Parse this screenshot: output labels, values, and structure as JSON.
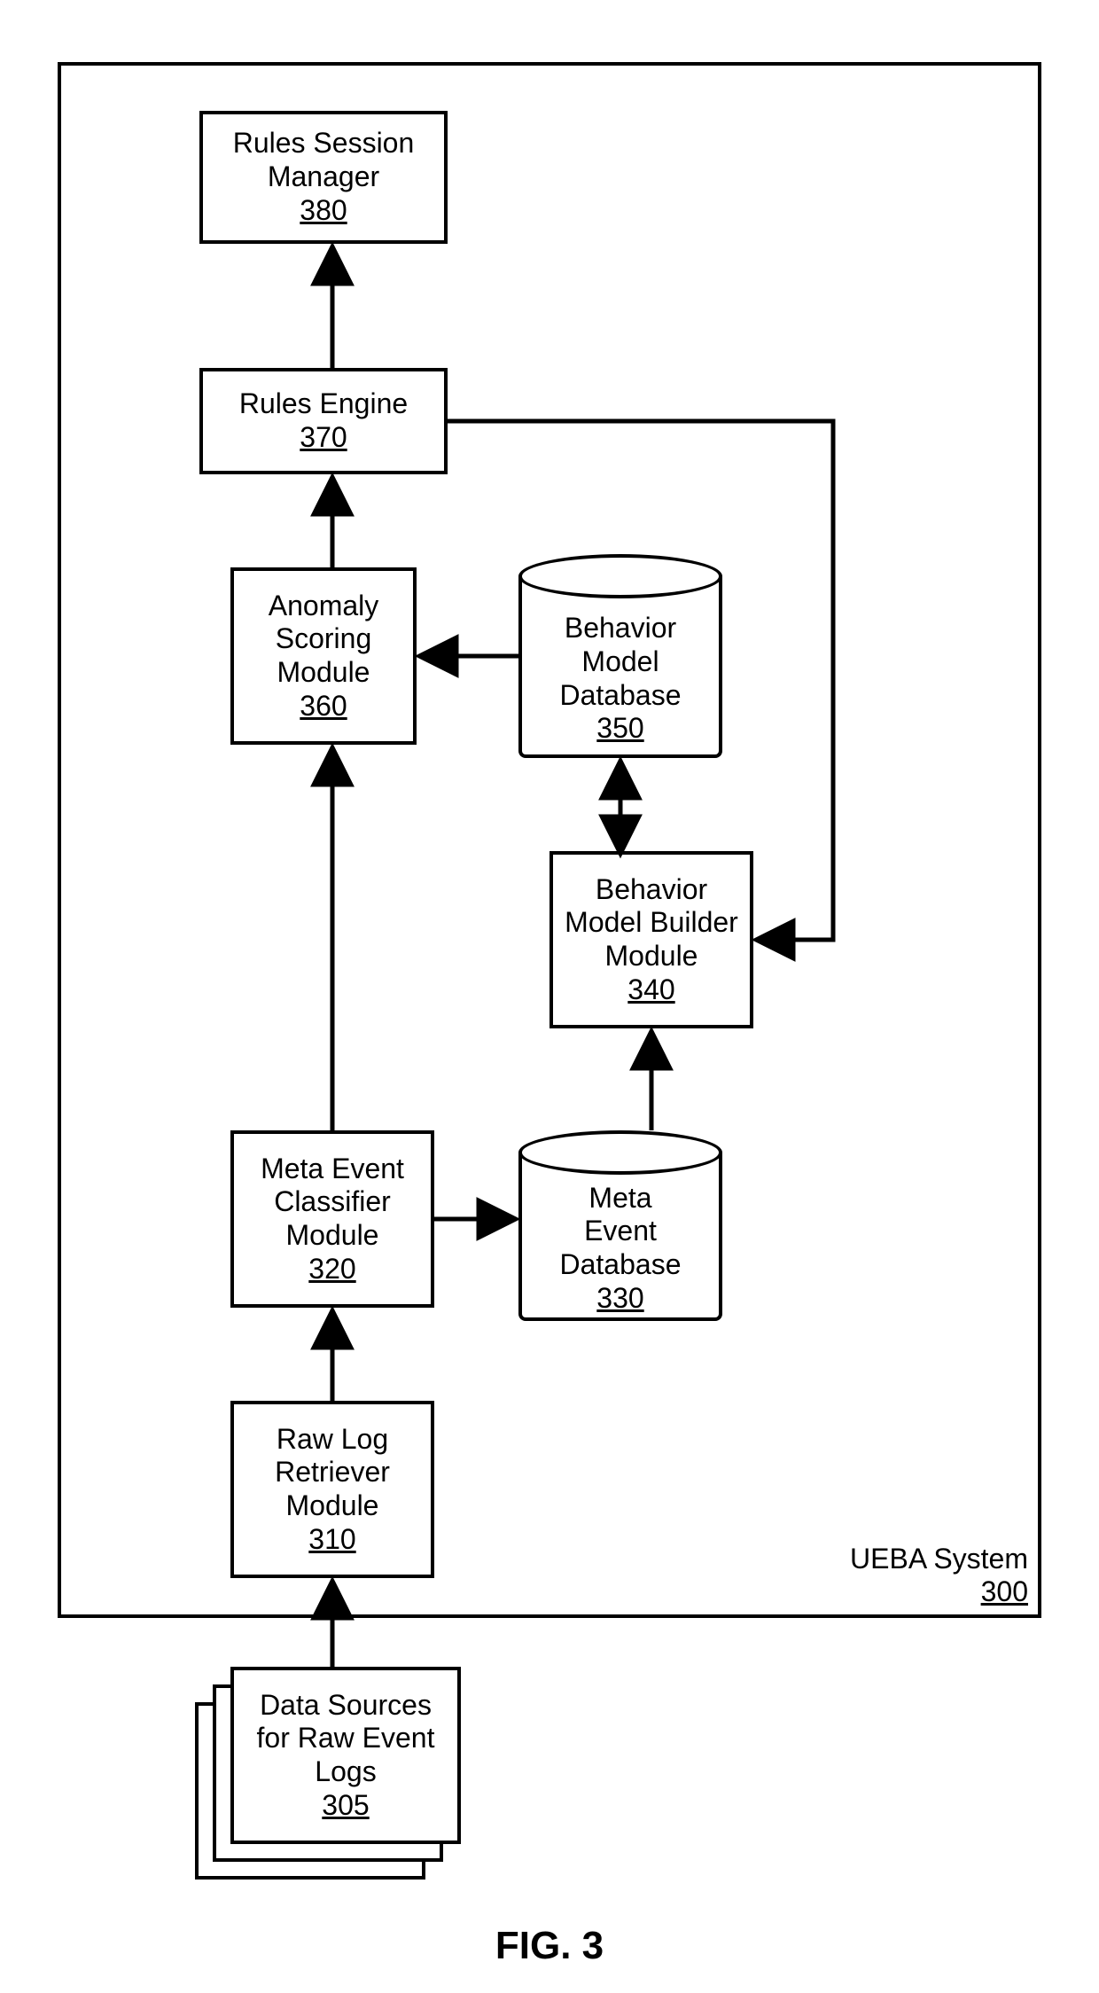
{
  "nodes": {
    "rulesSessionManager": {
      "lines": [
        "Rules Session",
        "Manager"
      ],
      "ref": "380"
    },
    "rulesEngine": {
      "lines": [
        "Rules Engine"
      ],
      "ref": "370"
    },
    "anomalyScoring": {
      "lines": [
        "Anomaly",
        "Scoring",
        "Module"
      ],
      "ref": "360"
    },
    "behaviorModelDb": {
      "lines": [
        "Behavior",
        "Model",
        "Database"
      ],
      "ref": "350"
    },
    "behaviorModelBuilder": {
      "lines": [
        "Behavior",
        "Model Builder",
        "Module"
      ],
      "ref": "340"
    },
    "metaEventClassifier": {
      "lines": [
        "Meta Event",
        "Classifier",
        "Module"
      ],
      "ref": "320"
    },
    "metaEventDb": {
      "lines": [
        "Meta",
        "Event",
        "Database"
      ],
      "ref": "330"
    },
    "rawLogRetriever": {
      "lines": [
        "Raw Log",
        "Retriever",
        "Module"
      ],
      "ref": "310"
    },
    "dataSources": {
      "lines": [
        "Data Sources",
        "for Raw Event",
        "Logs"
      ],
      "ref": "305"
    }
  },
  "system": {
    "label": "UEBA System",
    "ref": "300"
  },
  "figure_label": "FIG. 3"
}
